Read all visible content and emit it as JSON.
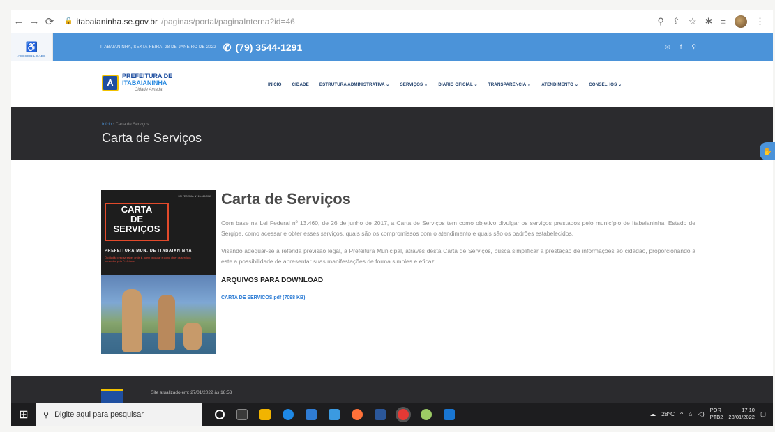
{
  "browser": {
    "url_domain": "itabaianinha.se.gov.br",
    "url_path": "/paginas/portal/paginaInterna?id=46"
  },
  "accessibility": {
    "label": "ACESSIBILIDADE"
  },
  "topbar": {
    "date": "ITABAIANINHA, SEXTA-FEIRA, 28 DE JANEIRO DE 2022",
    "phone": "(79) 3544-1291"
  },
  "logo": {
    "line1": "PREFEITURA DE",
    "line2": "ITABAIANINHA",
    "tagline": "Cidade Amada"
  },
  "menu": {
    "items": [
      "INÍCIO",
      "CIDADE",
      "ESTRUTURA ADMINISTRATIVA ⌄",
      "SERVIÇOS ⌄",
      "DIÁRIO OFICIAL ⌄",
      "TRANSPARÊNCIA ⌄",
      "ATENDIMENTO ⌄",
      "CONSELHOS ⌄"
    ]
  },
  "banner": {
    "crumb_home": "Início",
    "crumb_current": "Carta de Serviços",
    "title": "Carta de Serviços"
  },
  "cover": {
    "top_note": "LEI FEDERAL Nº 13.460/2017",
    "line1": "CARTA",
    "line2": "DE",
    "line3": "SERVIÇOS",
    "prefeitura": "PREFEITURA MUN. DE ITABAIANINHA",
    "desc": "O cidadão precisa saber onde ir, quem procurar e como obter os serviços prestados pela Prefeitura."
  },
  "article": {
    "heading": "Carta de Serviços",
    "paragraph1": "Com base na Lei Federal nº 13.460, de 26 de junho de 2017, a Carta de Serviços tem como objetivo divulgar os serviços prestados pelo município de Itabaianinha, Estado de Sergipe, como acessar e obter esses serviços, quais são os compromissos com o atendimento e quais são os padrões estabelecidos.",
    "paragraph2": "Visando adequar-se a referida previsão legal, a Prefeitura Municipal, através desta Carta de Serviços, busca simplificar a prestação de informações ao cidadão, proporcionando a este a possibilidade de apresentar suas manifestações de forma simples e eficaz.",
    "downloads_title": "ARQUIVOS PARA DOWNLOAD",
    "download_link": "CARTA DE SERVICOS.pdf (7098 KB)"
  },
  "footer": {
    "updated": "Site atualizado em: 27/01/2022 às 18:53"
  },
  "taskbar": {
    "search_placeholder": "Digite aqui para pesquisar",
    "weather": "28°C",
    "lang1": "POR",
    "lang2": "PTB2",
    "time": "17:10",
    "date": "28/01/2022"
  }
}
